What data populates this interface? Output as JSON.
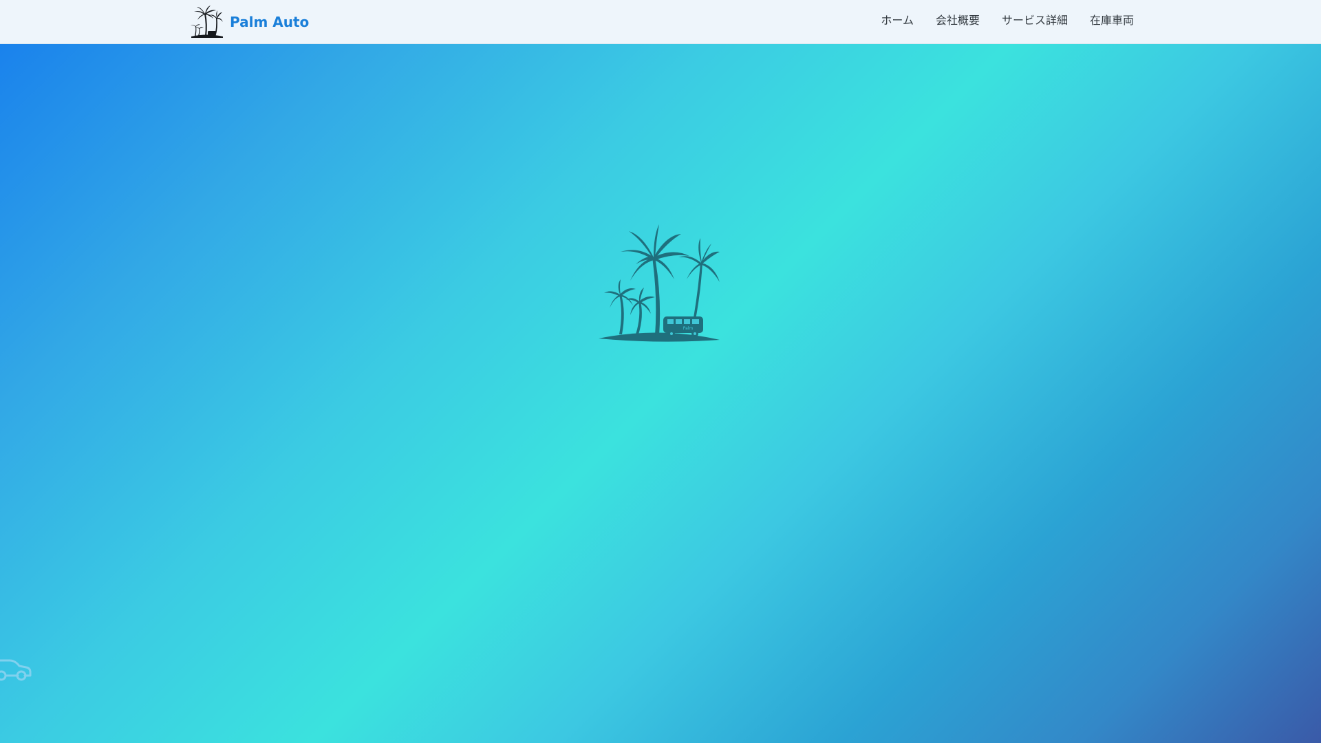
{
  "header": {
    "brand_name": "Palm Auto",
    "brand_color": "#1a7fd9",
    "logo_icon": "palm-trees-bus-logo",
    "nav": [
      {
        "label": "ホーム"
      },
      {
        "label": "会社概要"
      },
      {
        "label": "サービス詳細"
      },
      {
        "label": "在庫車両"
      }
    ]
  },
  "hero": {
    "emblem_icon": "palm-island-van-emblem",
    "emblem_van_text": "Palm",
    "decor_icon": "car-outline-icon",
    "gradient_colors": [
      "#1a82ec",
      "#3be2de",
      "#3a5aa8"
    ]
  }
}
